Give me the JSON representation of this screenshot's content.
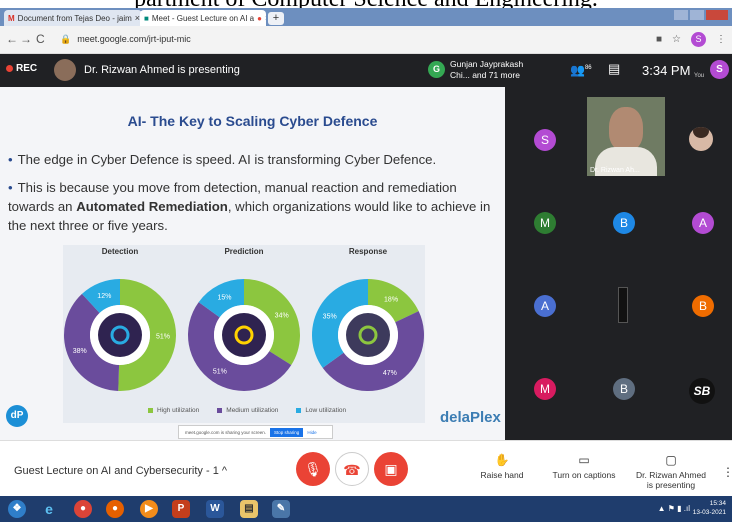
{
  "caption_text": "partment of Computer Science and Engineering.",
  "tabs": [
    {
      "label": "Document from Tejas Deo - jaim",
      "icon": "gmail-icon"
    },
    {
      "label": "Meet - Guest Lecture on AI a",
      "icon": "meet-icon"
    }
  ],
  "browser": {
    "url": "meet.google.com/jrt-iput-mic",
    "new_tab": "+"
  },
  "meet_top": {
    "rec_label": "REC",
    "presenting_text": "Dr. Rizwan Ahmed is presenting",
    "others_initial": "G",
    "others_text": "Gunjan Jayprakash Chi... and 71 more",
    "people_count": "86",
    "time": "3:34 PM",
    "you_initial": "S",
    "you_label": "You",
    "colors": {
      "rec": "#ea4335",
      "bar": "#202124"
    }
  },
  "slide": {
    "title": "AI- The Key to Scaling Cyber Defence",
    "bullet1": "The edge in Cyber Defence is speed. AI is transforming Cyber Defence.",
    "bullet2_pre": "This is because you move from detection, manual reaction and remediation towards an ",
    "bullet2_bold": "Automated Remediation",
    "bullet2_post": ", which organizations would like to achieve in the next three or five years.",
    "brand": "delaPlex",
    "logo_text": "dP",
    "share_text": "meet.google.com is sharing your screen.",
    "stop_sharing": "Stop sharing",
    "hide": "Hide"
  },
  "chart_data": [
    {
      "type": "pie",
      "title": "Detection",
      "categories": [
        "High utilization",
        "Medium utilization",
        "Low utilization"
      ],
      "values": [
        51,
        38,
        12
      ]
    },
    {
      "type": "pie",
      "title": "Prediction",
      "categories": [
        "High utilization",
        "Medium utilization",
        "Low utilization"
      ],
      "values": [
        34,
        51,
        15
      ]
    },
    {
      "type": "pie",
      "title": "Response",
      "categories": [
        "High utilization",
        "Medium utilization",
        "Low utilization"
      ],
      "values": [
        18,
        47,
        35
      ]
    }
  ],
  "chart_labels": [
    "51%",
    "38%",
    "12%",
    "34%",
    "51%",
    "15%",
    "18%",
    "47%",
    "35%"
  ],
  "legend": [
    {
      "label": "High utilization",
      "color": "#8cc63f"
    },
    {
      "label": "Medium utilization",
      "color": "#6a4c9c"
    },
    {
      "label": "Low utilization",
      "color": "#29abe2"
    }
  ],
  "participants": [
    {
      "initial": "S",
      "color": "#b34bd3"
    },
    {
      "initial": "M",
      "color": "#2e7d32"
    },
    {
      "initial": "B",
      "color": "#1e88e5"
    },
    {
      "initial": "A",
      "color": "#b34bd3"
    },
    {
      "initial": "A",
      "color": "#4a6fd1"
    },
    {
      "initial": "B",
      "color": "#ef6c00"
    },
    {
      "initial": "M",
      "color": "#d81b60"
    },
    {
      "initial": "B",
      "color": "#5f6e80"
    }
  ],
  "presenter_tile_name": "Dr. Rizwan Ah...",
  "sb_label": "SB",
  "bottom": {
    "meeting_title": "Guest Lecture on AI and Cybersecurity - 1",
    "raise_hand": "Raise hand",
    "captions": "Turn on captions",
    "presenting": "Dr. Rizwan Ahmed is presenting"
  },
  "taskbar": {
    "time": "15:34",
    "date": "13-03-2021"
  }
}
